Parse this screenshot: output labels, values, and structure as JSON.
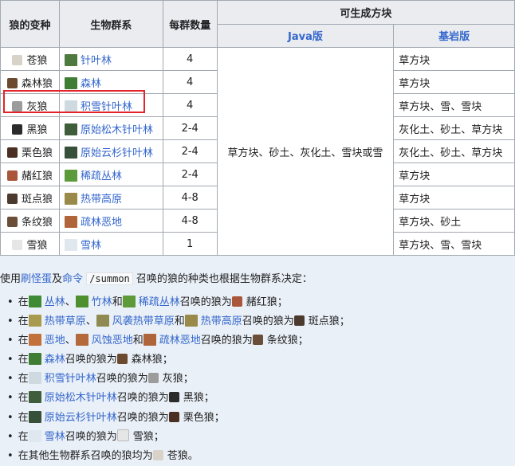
{
  "colors": {
    "link": "#3366cc",
    "header_bg": "#eaecf0",
    "border": "#a2a9b1",
    "highlight": "#e2232a",
    "page_bg": "#eaf0f7"
  },
  "table": {
    "headers": {
      "variant": "狼的变种",
      "biome": "生物群系",
      "count": "每群数量",
      "blocks": "可生成方块",
      "java": "Java版",
      "bedrock": "基岩版"
    },
    "java_merged": "草方块、砂土、灰化土、雪块或雪",
    "rows": [
      {
        "variant": "苍狼",
        "wolf_color": "#d9d2c8",
        "biome": "针叶林",
        "biome_icon": "taiga-icon",
        "biome_color": "#4f7a3f",
        "count": "4",
        "bedrock": "草方块"
      },
      {
        "variant": "森林狼",
        "wolf_color": "#6b4a30",
        "biome": "森林",
        "biome_icon": "forest-icon",
        "biome_color": "#3f7d35",
        "count": "4",
        "bedrock": "草方块"
      },
      {
        "variant": "灰狼",
        "wolf_color": "#9c9c9c",
        "biome": "积雪针叶林",
        "biome_icon": "snowy-taiga-icon",
        "biome_color": "#cfd9e0",
        "count": "4",
        "bedrock": "草方块、雪、雪块"
      },
      {
        "variant": "黑狼",
        "wolf_color": "#2b2b2b",
        "biome": "原始松木针叶林",
        "biome_icon": "old-growth-pine-taiga-icon",
        "biome_color": "#3f5d3a",
        "count": "2-4",
        "bedrock": "灰化土、砂土、草方块"
      },
      {
        "variant": "栗色狼",
        "wolf_color": "#4a2f22",
        "biome": "原始云杉针叶林",
        "biome_icon": "old-growth-spruce-taiga-icon",
        "biome_color": "#37503a",
        "count": "2-4",
        "bedrock": "灰化土、砂土、草方块"
      },
      {
        "variant": "赭红狼",
        "wolf_color": "#a9563a",
        "biome": "稀疏丛林",
        "biome_icon": "sparse-jungle-icon",
        "biome_color": "#5c9a3a",
        "count": "2-4",
        "bedrock": "草方块"
      },
      {
        "variant": "斑点狼",
        "wolf_color": "#4d3a2e",
        "biome": "热带高原",
        "biome_icon": "savanna-plateau-icon",
        "biome_color": "#9a8a4a",
        "count": "4-8",
        "bedrock": "草方块"
      },
      {
        "variant": "条纹狼",
        "wolf_color": "#6b4e38",
        "biome": "疏林恶地",
        "biome_icon": "wooded-badlands-icon",
        "biome_color": "#b0643a",
        "count": "4-8",
        "bedrock": "草方块、砂土"
      },
      {
        "variant": "雪狼",
        "wolf_color": "#e6e6e6",
        "biome": "雪林",
        "biome_icon": "snowy-forest-icon",
        "biome_color": "#dfe8ef",
        "count": "1",
        "bedrock": "草方块、雪、雪块"
      }
    ]
  },
  "intro": {
    "t1": "使用",
    "link1": "刷怪蛋",
    "t2": "及",
    "link2": "命令",
    "code": "/summon",
    "t3": "召唤的狼的种类也根据生物群系决定："
  },
  "bullets": {
    "b1": {
      "pre": "在",
      "l1": "丛林",
      "s1": "、",
      "l2": "竹林",
      "s2": "和",
      "l3": "稀疏丛林",
      "mid": "召唤的狼为",
      "wolf": "赭红狼",
      "end": "；"
    },
    "b2": {
      "pre": "在",
      "l1": "热带草原",
      "s1": "、",
      "l2": "风袭热带草原",
      "s2": "和",
      "l3": "热带高原",
      "mid": "召唤的狼为",
      "wolf": "斑点狼",
      "end": "；"
    },
    "b3": {
      "pre": "在",
      "l1": "恶地",
      "s1": "、",
      "l2": "风蚀恶地",
      "s2": "和",
      "l3": "疏林恶地",
      "mid": "召唤的狼为",
      "wolf": "条纹狼",
      "end": "；"
    },
    "b4": {
      "pre": "在",
      "l1": "森林",
      "mid": "召唤的狼为",
      "wolf": "森林狼",
      "end": "；"
    },
    "b5": {
      "pre": "在",
      "l1": "积雪针叶林",
      "mid": "召唤的狼为",
      "wolf": "灰狼",
      "end": "；"
    },
    "b6": {
      "pre": "在",
      "l1": "原始松木针叶林",
      "mid": "召唤的狼为",
      "wolf": "黑狼",
      "end": "；"
    },
    "b7": {
      "pre": "在",
      "l1": "原始云杉针叶林",
      "mid": "召唤的狼为",
      "wolf": "栗色狼",
      "end": "；"
    },
    "b8": {
      "pre": "在",
      "l1": "雪林",
      "mid": "召唤的狼为",
      "wolf": "雪狼",
      "end": "；"
    },
    "b9": {
      "pre": "在其他生物群系召唤的狼均为",
      "wolf": "苍狼",
      "end": "。"
    }
  }
}
